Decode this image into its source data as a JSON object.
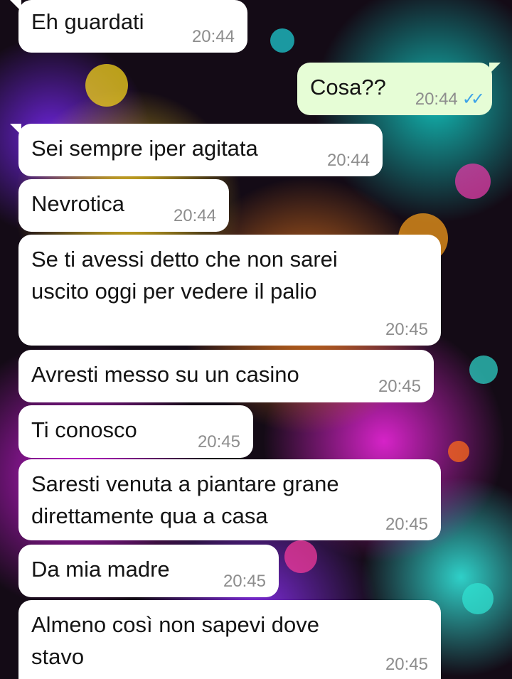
{
  "colors": {
    "incoming_bubble": "#ffffff",
    "outgoing_bubble": "#e6fdd6",
    "timestamp": "#8d8d8d",
    "read_ticks": "#3da3e8"
  },
  "messages": [
    {
      "direction": "incoming",
      "text": "Eh guardati",
      "time": "20:44"
    },
    {
      "direction": "outgoing",
      "text": "Cosa??",
      "time": "20:44",
      "status_icon": "double-check-read-icon"
    },
    {
      "direction": "incoming",
      "text": "Sei sempre iper agitata",
      "time": "20:44"
    },
    {
      "direction": "incoming",
      "text": "Nevrotica",
      "time": "20:44"
    },
    {
      "direction": "incoming",
      "lines": [
        "Se ti avessi detto che non sarei",
        "uscito oggi per vedere il palio"
      ],
      "time": "20:45"
    },
    {
      "direction": "incoming",
      "text": "Avresti messo su un casino",
      "time": "20:45"
    },
    {
      "direction": "incoming",
      "text": "Ti conosco",
      "time": "20:45"
    },
    {
      "direction": "incoming",
      "lines": [
        "Saresti venuta a piantare grane",
        "direttamente qua a casa"
      ],
      "time": "20:45"
    },
    {
      "direction": "incoming",
      "text": "Da mia madre",
      "time": "20:45"
    },
    {
      "direction": "incoming",
      "lines": [
        "Almeno così non sapevi dove",
        "stavo"
      ],
      "time": "20:45"
    }
  ]
}
